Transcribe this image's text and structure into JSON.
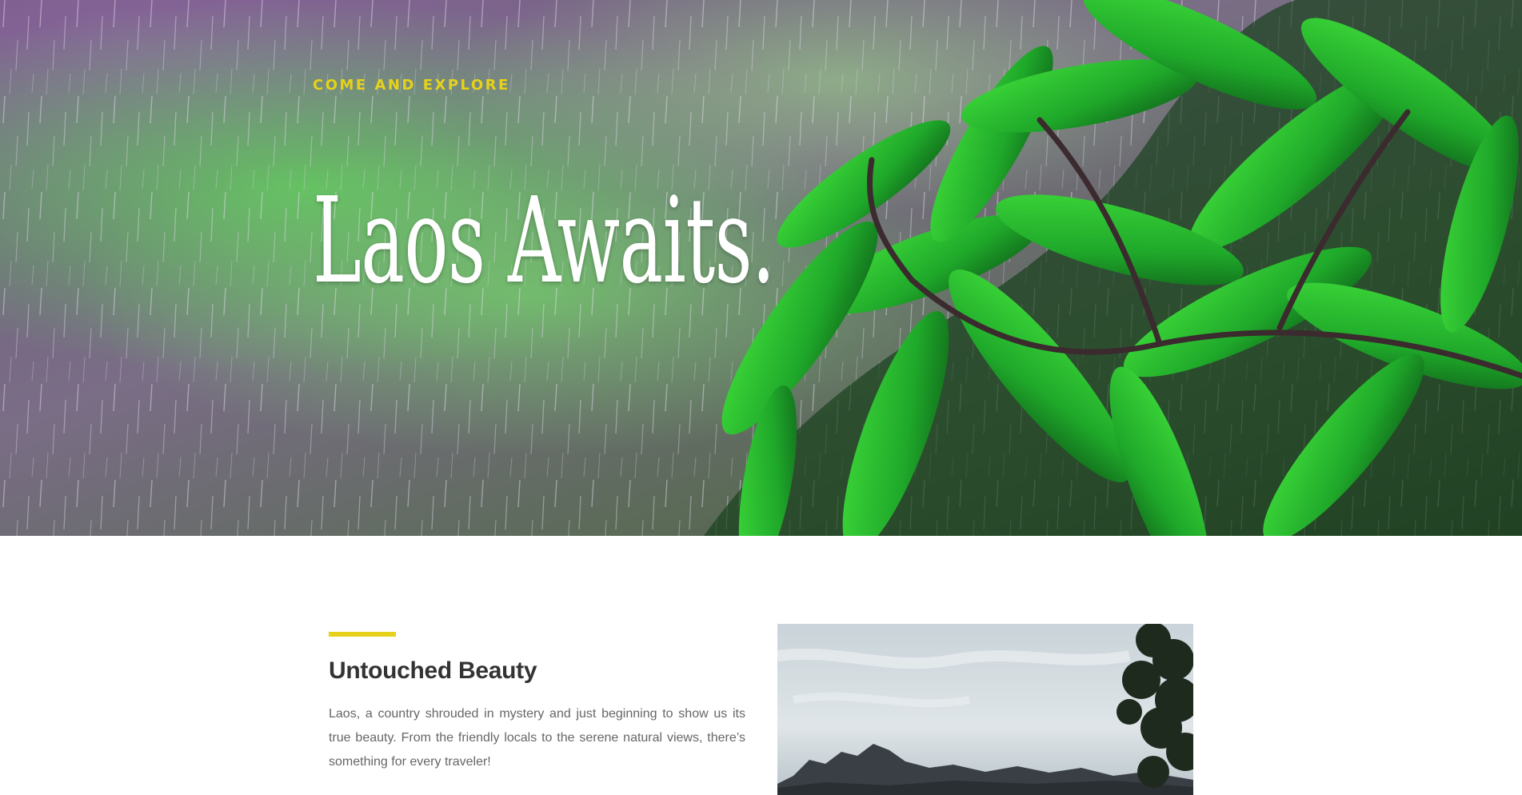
{
  "hero": {
    "eyebrow": "Come and Explore",
    "title": "Laos Awaits."
  },
  "intro": {
    "heading": "Untouched Beauty",
    "body": "Laos, a country shrouded in mystery and just beginning to show us its true beauty. From the friendly locals to the serene natural views, there’s something for every traveler!"
  },
  "colors": {
    "accent": "#e6d21a",
    "heading": "#333333",
    "body_text": "#666666"
  }
}
